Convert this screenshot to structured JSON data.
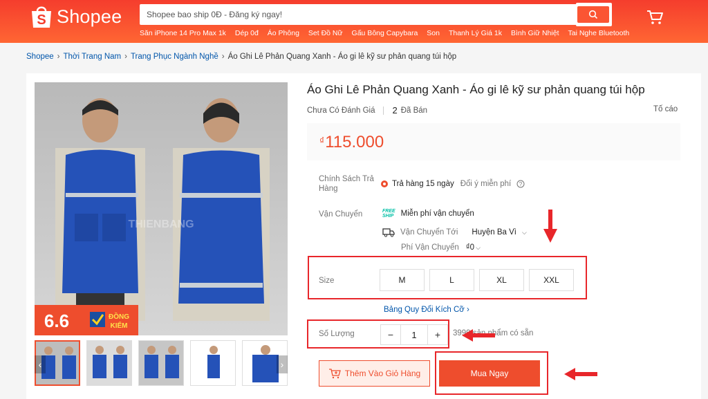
{
  "header": {
    "logo_text": "Shopee",
    "search_placeholder": "Shopee bao ship 0Đ - Đăng ký ngay!",
    "suggestions": [
      "Săn iPhone 14 Pro Max 1k",
      "Dép 0đ",
      "Áo Phông",
      "Set Đồ Nữ",
      "Gấu Bông Capybara",
      "Son",
      "Thanh Lý Giá 1k",
      "Bình Giữ Nhiệt",
      "Tai Nghe Bluetooth"
    ],
    "brand_color": "#ee4d2d"
  },
  "breadcrumb": [
    "Shopee",
    "Thời Trang Nam",
    "Trang Phục Ngành Nghề",
    "Áo Ghi Lê Phản Quang Xanh - Áo gi lê kỹ sư phản quang túi hộp"
  ],
  "gallery": {
    "watermark": "THIENBANG",
    "badge_number": "6.6",
    "badge_line1": "ĐỒNG",
    "badge_line2": "KIỂM",
    "prev": "‹",
    "next": "›"
  },
  "product": {
    "title": "Áo Ghi Lê Phản Quang Xanh - Áo gi lê kỹ sư phản quang túi hộp",
    "rating_text": "Chưa Có Đánh Giá",
    "sold_count": "2",
    "sold_label": "Đã Bán",
    "report": "Tố cáo",
    "currency": "₫",
    "price": "115.000"
  },
  "return_policy": {
    "label": "Chính Sách Trả Hàng",
    "value": "Trả hàng 15 ngày",
    "extra": "Đổi ý miễn phí"
  },
  "shipping": {
    "label": "Vận Chuyển",
    "free_badge_line1": "FREE",
    "free_badge_line2": "SHIP",
    "free_text": "Miễn phí vận chuyển",
    "to_label": "Vận Chuyển Tới",
    "to_value": "Huyện Ba Vì",
    "fee_label": "Phí Vận Chuyển",
    "fee_value": "₫0"
  },
  "size": {
    "label": "Size",
    "options": [
      "M",
      "L",
      "XL",
      "XXL"
    ],
    "guide": "Bảng Quy Đổi Kích Cỡ"
  },
  "quantity": {
    "label": "Số Lượng",
    "minus": "−",
    "value": "1",
    "plus": "+",
    "stock": "3999 sản phẩm có sẵn"
  },
  "actions": {
    "add_to_cart": "Thêm Vào Giỏ Hàng",
    "buy_now": "Mua Ngay"
  },
  "annotation_color": "#e8262a"
}
